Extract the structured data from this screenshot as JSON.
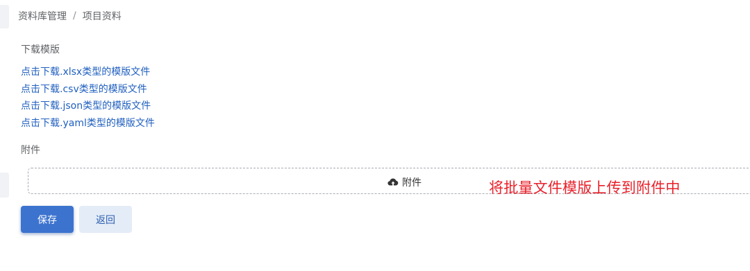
{
  "breadcrumb": {
    "parent": "资料库管理",
    "separator": "/",
    "current": "项目资料"
  },
  "templates": {
    "label": "下载模版",
    "links": [
      "点击下载.xlsx类型的模版文件",
      "点击下载.csv类型的模版文件",
      "点击下载.json类型的模版文件",
      "点击下载.yaml类型的模版文件"
    ]
  },
  "attachments": {
    "label": "附件",
    "upload_label": "附件",
    "upload_icon": "cloud-upload-icon"
  },
  "annotation": {
    "text": "将批量文件模版上传到附件中",
    "color": "#e8202a"
  },
  "actions": {
    "save_label": "保存",
    "back_label": "返回"
  },
  "colors": {
    "primary": "#3c73cf",
    "link": "#1f5fbf",
    "secondary_bg": "#e4ecf7"
  }
}
